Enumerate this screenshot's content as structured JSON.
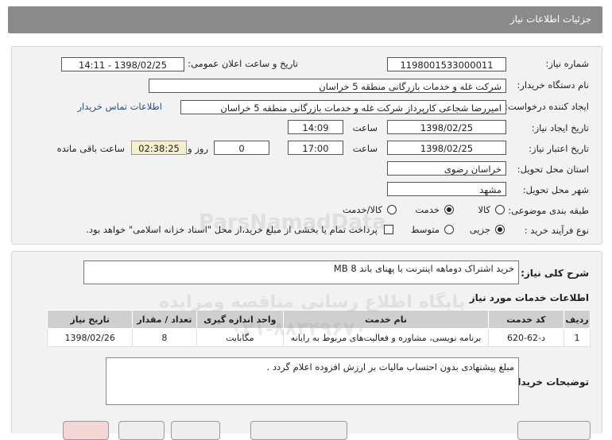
{
  "header": {
    "title": "جزئیات اطلاعات نیاز"
  },
  "form": {
    "need_number_label": "شماره نیاز:",
    "need_number": "1198001533000011",
    "announce_label": "تاریخ و ساعت اعلان عمومی:",
    "announce_value": "1398/02/25 - 14:11",
    "buyer_org_label": "نام دستگاه خریدار:",
    "buyer_org": "شرکت غله و خدمات بازرگانی منطقه 5 خراسان",
    "requester_label": "ایجاد کننده درخواست:",
    "requester": "امیررضا شجاعی کارپرداز شرکت غله و خدمات بازرگانی منطقه 5 خراسان",
    "contact_link": "اطلاعات تماس خریدار",
    "created_date_label": "تاریخ ایجاد نیاز:",
    "created_date": "1398/02/25",
    "time_label": "ساعت",
    "created_time": "14:09",
    "validity_label": "تاریخ اعتبار نیاز:",
    "validity_date": "1398/02/25",
    "validity_time": "17:00",
    "days_value": "0",
    "days_label": "روز و",
    "remaining_time": "02:38:25",
    "remaining_label": "ساعت باقی مانده",
    "province_label": "استان محل تحویل:",
    "province": "خراسان رضوی",
    "city_label": "شهر محل تحویل:",
    "city": "مشهد",
    "category_label": "طبقه بندی موضوعی:",
    "category_options": [
      "کالا",
      "خدمت",
      "کالا/خدمت"
    ],
    "purchase_label": "نوع فرآیند خرید :",
    "purchase_options": [
      "جزیی",
      "متوسط"
    ],
    "treasury_note": "پرداخت تمام یا بخشی از مبلغ خرید،از محل \"اسناد خزانه اسلامی\" خواهد بود."
  },
  "summary": {
    "label": "شرح کلی نیاز:",
    "value": "خرید اشتراک دوماهه اینترنت با پهنای باند 8 MB"
  },
  "services": {
    "title": "اطلاعات خدمات مورد نیاز",
    "columns": [
      "ردیف",
      "کد خدمت",
      "نام خدمت",
      "واحد اندازه گیری",
      "تعداد / مقدار",
      "تاریخ نیاز"
    ],
    "rows": [
      [
        "1",
        "د-62-620",
        "برنامه نویسی، مشاوره و فعالیت‌های مربوط به رایانه",
        "مگابایت",
        "8",
        "1398/02/26"
      ]
    ]
  },
  "buyer_notes": {
    "label": "توضیحات خریدار:",
    "value": "مبلغ پیشنهادی بدون احتساب مالیات بر ارزش افزوده اعلام گردد ."
  },
  "watermark": {
    "brand": "ParsNamadData",
    "persian_line": "پایگاه اطلاع رسانی مناقصه ومزایده",
    "phone": "۰۲۱-۸۸۳۴۹۶۷۰"
  },
  "colors": {
    "header_bg": "#8a8a8a",
    "panel_bg": "#f2f2f2",
    "link": "#1a4f9c"
  }
}
